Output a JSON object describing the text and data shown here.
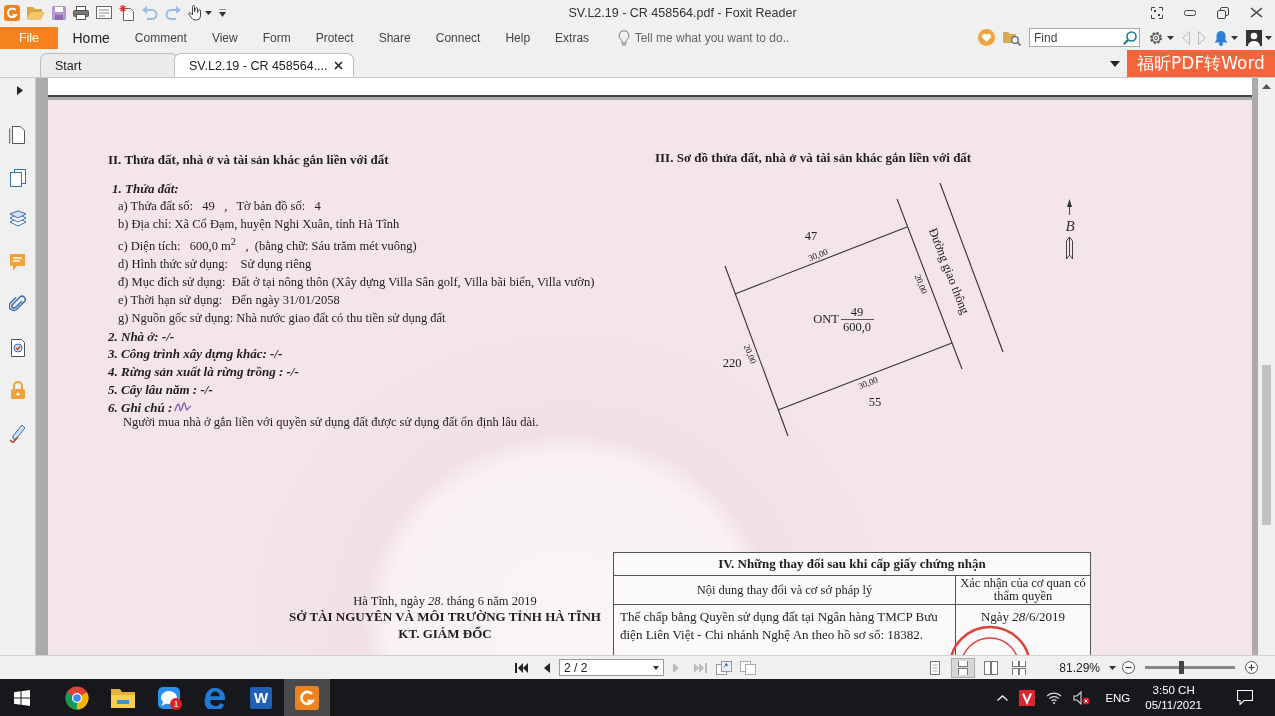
{
  "window": {
    "title": "SV.L2.19 - CR 458564.pdf - Foxit Reader"
  },
  "ribbon": {
    "file_label": "File",
    "tabs": [
      {
        "label": "Home",
        "selected": true
      },
      {
        "label": "Comment",
        "selected": false
      },
      {
        "label": "View",
        "selected": false
      },
      {
        "label": "Form",
        "selected": false
      },
      {
        "label": "Protect",
        "selected": false
      },
      {
        "label": "Share",
        "selected": false
      },
      {
        "label": "Connect",
        "selected": false
      },
      {
        "label": "Help",
        "selected": false
      },
      {
        "label": "Extras",
        "selected": false
      }
    ],
    "tell_me": {
      "placeholder": "Tell me what you want to do.."
    },
    "find": {
      "placeholder": "Find"
    }
  },
  "document_tabs": [
    {
      "label": "Start",
      "selected": false
    },
    {
      "label": "SV.L2.19 - CR 458564....",
      "selected": true
    }
  ],
  "promo_banner": "福昕PDF转Word",
  "document": {
    "land_section": {
      "heading": "II. Thửa đất, nhà ở và tài sản khác gắn liền với đất",
      "parcel_heading": "1. Thửa đất:",
      "parcel_lines": [
        "a) Thửa đất số:   49   ,   Tờ bản đồ số:   4",
        "b) Địa chỉ: Xã Cổ Đạm, huyện Nghi Xuân, tỉnh Hà Tĩnh",
        "c) Diện tích:   600,0 m$^{2}$   ,  (bằng chữ: Sáu trăm mét vuông)",
        "d) Hình thức sử dụng:    Sử dụng riêng",
        "đ) Mục đích sử dụng:  Đất ở tại nông thôn (Xây dựng Villa Sân golf, Villa bãi biển, Villa vườn)",
        "e) Thời hạn sử dụng:   Đến ngày 31/01/2058",
        "g) Nguồn gốc sử dụng: Nhà nước giao đất có thu tiền sử dụng đất"
      ],
      "other_items": [
        {
          "text": "2. Nhà ở: -/-",
          "initialed": false
        },
        {
          "text": "3. Công trình xây dựng khác: -/-",
          "initialed": false
        },
        {
          "text": "4. Rừng sản xuất là rừng trồng : -/-",
          "initialed": false
        },
        {
          "text": "5. Cây lâu năm : -/-",
          "initialed": false
        },
        {
          "text": "6. Ghi chú :",
          "initialed": true
        }
      ],
      "note": "Người mua nhà ở gắn liền với quyền sử dụng đất được sử dụng đất ổn định lâu dài."
    },
    "plot_section": {
      "heading": "III. Sơ đồ thửa đất, nhà ở và tài sản khác gắn liền với đất",
      "plot": {
        "land_code": "ONT",
        "number": "49",
        "area": "600,0"
      },
      "neighbors": [
        "47",
        "220",
        "55"
      ],
      "edge_lengths": [
        "30,00",
        "20,00",
        "30,00",
        "20,00"
      ],
      "road": "Đường giao thông",
      "north_label": "B"
    },
    "signature": {
      "place_date": "Hà Tĩnh, ngày *28*. tháng 6 năm 2019",
      "agency": "SỞ TÀI NGUYÊN VÀ MÔI TRƯỜNG TỈNH HÀ TĨNH",
      "signer_title": "KT. GIÁM ĐỐC"
    },
    "changes_table": {
      "title": "IV. Những thay đổi sau khi cấp giấy chứng nhận",
      "columns": [
        "Nội dung thay đổi và cơ sở pháp lý",
        "Xác nhận của cơ quan có thẩm quyền"
      ],
      "rows": [
        {
          "content": "Thế chấp bằng Quyền sử dụng đất tại Ngân hàng TMCP Bưu điện Liên Việt - Chi nhánh Nghệ An theo hồ sơ số: 18382.",
          "confirmation": "Ngày *28*/6/2019",
          "stamped": true
        }
      ]
    }
  },
  "page_nav": {
    "buttons": [
      {
        "kind": "first",
        "disabled": false
      },
      {
        "kind": "previous",
        "disabled": false
      },
      {
        "kind": "next",
        "disabled": true
      },
      {
        "kind": "last",
        "disabled": true
      }
    ],
    "page_field": "2 / 2"
  },
  "view_modes": [
    {
      "kind": "single",
      "selected": false
    },
    {
      "kind": "continuous",
      "selected": true
    },
    {
      "kind": "facing",
      "selected": false
    },
    {
      "kind": "continuous_facing",
      "selected": false
    }
  ],
  "zoom": {
    "value": "81.29%",
    "level": 0.4
  },
  "taskbar": {
    "apps": [
      {
        "kind": "browser",
        "selected": false
      },
      {
        "kind": "folder",
        "selected": false
      },
      {
        "kind": "chat",
        "selected": false,
        "badge": "1"
      },
      {
        "kind": "edge",
        "selected": false
      },
      {
        "kind": "word",
        "selected": false,
        "letter": "W"
      },
      {
        "kind": "pdf",
        "selected": true
      }
    ],
    "language": "ENG",
    "time": "3:50 CH",
    "date": "05/11/2021"
  }
}
